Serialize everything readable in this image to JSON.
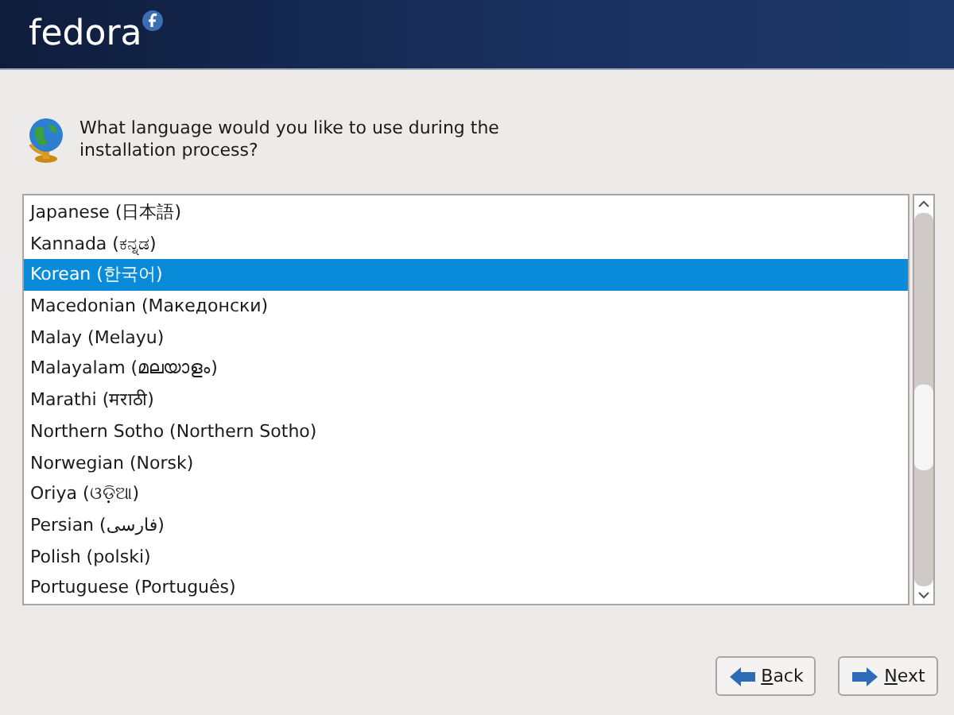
{
  "header": {
    "logo": "fedora"
  },
  "prompt": "What language would you like to use during the installation process?",
  "languages": [
    {
      "label": "Japanese (日本語)",
      "selected": false
    },
    {
      "label": "Kannada (ಕನ್ನಡ)",
      "selected": false
    },
    {
      "label": "Korean (한국어)",
      "selected": true
    },
    {
      "label": "Macedonian (Македонски)",
      "selected": false
    },
    {
      "label": "Malay (Melayu)",
      "selected": false
    },
    {
      "label": "Malayalam (മലയാളം)",
      "selected": false
    },
    {
      "label": "Marathi (मराठी)",
      "selected": false
    },
    {
      "label": "Northern Sotho (Northern Sotho)",
      "selected": false
    },
    {
      "label": "Norwegian (Norsk)",
      "selected": false
    },
    {
      "label": "Oriya (ଓଡ଼ିଆ)",
      "selected": false
    },
    {
      "label": "Persian (فارسی)",
      "selected": false
    },
    {
      "label": "Polish (polski)",
      "selected": false
    },
    {
      "label": "Portuguese (Português)",
      "selected": false
    }
  ],
  "buttons": [
    {
      "label": "Back",
      "kind": "back"
    },
    {
      "label": "Next",
      "kind": "next"
    }
  ]
}
